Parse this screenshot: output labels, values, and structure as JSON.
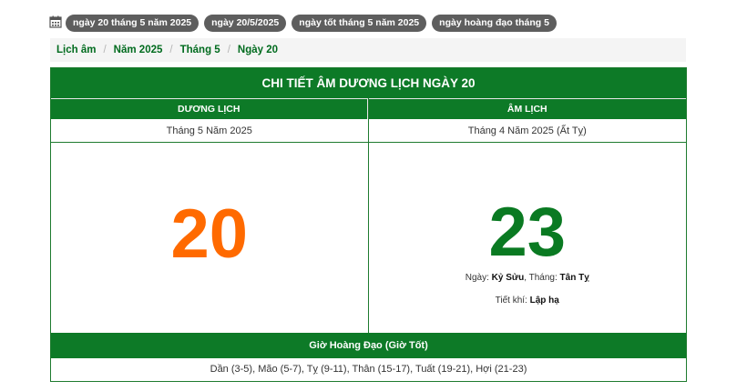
{
  "tags": [
    "ngày 20 tháng 5 năm 2025",
    "ngày 20/5/2025",
    "ngày tốt tháng 5 năm 2025",
    "ngày hoàng đạo tháng 5"
  ],
  "breadcrumb": [
    "Lịch âm",
    "Năm 2025",
    "Tháng 5",
    "Ngày 20"
  ],
  "title": "CHI TIẾT ÂM DƯƠNG LỊCH NGÀY 20",
  "solar": {
    "header": "DƯƠNG LỊCH",
    "month_year": "Tháng 5 Năm 2025",
    "day": "20"
  },
  "lunar": {
    "header": "ÂM LỊCH",
    "month_year": "Tháng 4 Năm 2025 (Ất Tỵ)",
    "day": "23",
    "day_label": "Ngày: ",
    "day_canchi": "Kỷ Sửu",
    "month_label": ", Tháng: ",
    "month_canchi": "Tân Tỵ",
    "term_label": "Tiết khí: ",
    "term": "Lập hạ"
  },
  "good_hours": {
    "header": "Giờ Hoàng Đạo (Giờ Tốt)",
    "list": "Dần (3-5), Mão (5-7), Tỵ (9-11), Thân (15-17), Tuất (19-21), Hợi (21-23)"
  },
  "colors": {
    "green": "#0d7a27",
    "orange": "#ff6a00",
    "tag_bg": "#5e5e5e"
  },
  "icons": [
    "calendar-icon"
  ]
}
